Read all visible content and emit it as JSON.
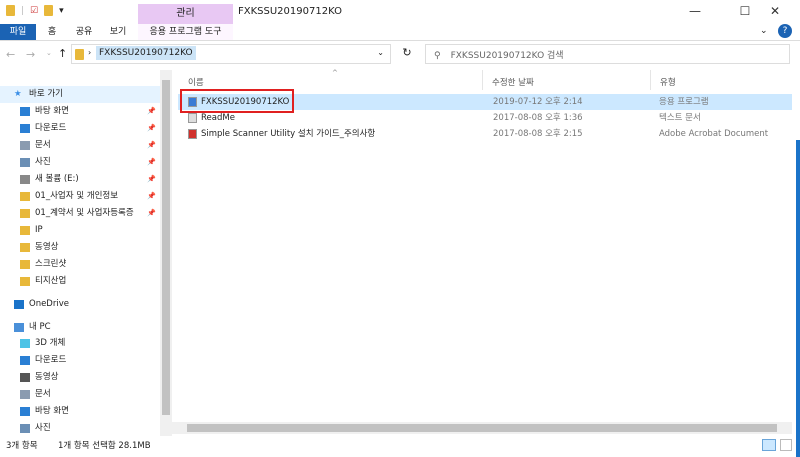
{
  "window": {
    "title": "FXKSSU20190712KO",
    "minimize": "—",
    "maximize": "☐",
    "close": "✕"
  },
  "ribbon": {
    "context_group": "관리",
    "tabs": [
      "파일",
      "홈",
      "공유",
      "보기",
      "응용 프로그램 도구"
    ],
    "help": "?"
  },
  "address": {
    "path": "FXKSSU20190712KO",
    "search_placeholder": "FXKSSU20190712KO 검색"
  },
  "sidebar": {
    "items": [
      {
        "label": "바로 가기",
        "icon": "star-icon",
        "pinned": false
      },
      {
        "label": "바탕 화면",
        "icon": "desktop-icon",
        "pinned": true
      },
      {
        "label": "다운로드",
        "icon": "download-icon",
        "pinned": true
      },
      {
        "label": "문서",
        "icon": "document-icon",
        "pinned": true
      },
      {
        "label": "사진",
        "icon": "pictures-icon",
        "pinned": true
      },
      {
        "label": "새 볼륨 (E:)",
        "icon": "drive-icon",
        "pinned": true
      },
      {
        "label": "01_사업자 및 개인정보",
        "icon": "folder-icon",
        "pinned": true
      },
      {
        "label": "01_계약서 및 사업자등록증",
        "icon": "folder-icon",
        "pinned": true
      },
      {
        "label": "IP",
        "icon": "folder-icon",
        "pinned": false
      },
      {
        "label": "동영상",
        "icon": "folder-icon",
        "pinned": false
      },
      {
        "label": "스크린샷",
        "icon": "folder-icon",
        "pinned": false
      },
      {
        "label": "티지산업",
        "icon": "folder-icon",
        "pinned": false
      },
      {
        "label": "OneDrive",
        "icon": "cloud-icon",
        "pinned": false
      },
      {
        "label": "내 PC",
        "icon": "pc-icon",
        "pinned": false
      },
      {
        "label": "3D 개체",
        "icon": "3d-objects-icon",
        "pinned": false
      },
      {
        "label": "다운로드",
        "icon": "download-icon",
        "pinned": false
      },
      {
        "label": "동영상",
        "icon": "video-icon",
        "pinned": false
      },
      {
        "label": "문서",
        "icon": "document-icon",
        "pinned": false
      },
      {
        "label": "바탕 화면",
        "icon": "desktop-icon",
        "pinned": false
      },
      {
        "label": "사진",
        "icon": "pictures-icon",
        "pinned": false
      }
    ]
  },
  "columns": {
    "name": "이름",
    "date": "수정한 날짜",
    "type": "유형"
  },
  "files": [
    {
      "name": "FXKSSU20190712KO",
      "date": "2019-07-12 오후 2:14",
      "type": "응용 프로그램",
      "icon": "installer-icon",
      "selected": true
    },
    {
      "name": "ReadMe",
      "date": "2017-08-08 오후 1:36",
      "type": "텍스트 문서",
      "icon": "text-file-icon",
      "selected": false
    },
    {
      "name": "Simple Scanner Utility 설치 가이드_주의사항",
      "date": "2017-08-08 오후 2:15",
      "type": "Adobe Acrobat Document",
      "icon": "pdf-icon",
      "selected": false
    }
  ],
  "status": {
    "count": "3개 항목",
    "selection": "1개 항목 선택함 28.1MB"
  }
}
